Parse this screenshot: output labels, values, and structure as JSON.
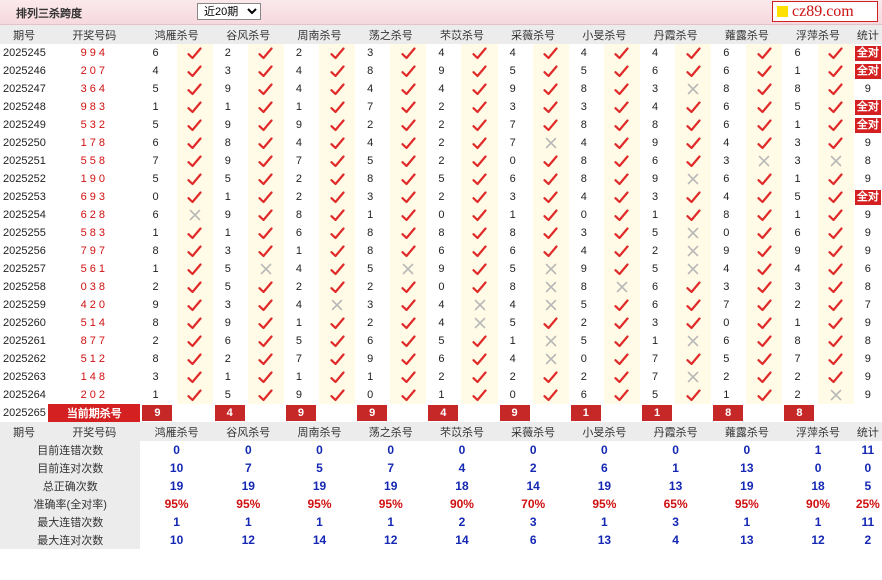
{
  "header": {
    "title": "排列三杀跨度",
    "period_select": "近20期",
    "logo_text": "cz89.com"
  },
  "colors": {
    "accent_red": "#d42020",
    "number_blue": "#1428b4",
    "tick": "#e02a2a",
    "cross": "#b9b9b9"
  },
  "icons": {
    "ok": "check-icon",
    "fail": "cross-icon"
  },
  "table": {
    "col_issue": "期号",
    "col_draw": "开奖号码",
    "col_stat": "统计",
    "experts": [
      "鸿雁杀号",
      "谷风杀号",
      "周南杀号",
      "荡之杀号",
      "芣苡杀号",
      "采薇杀号",
      "小旻杀号",
      "丹霞杀号",
      "蕹露杀号",
      "浮萍杀号"
    ],
    "rows": [
      {
        "issue": "2025245",
        "draw": "994",
        "nums": [
          6,
          2,
          2,
          3,
          4,
          4,
          4,
          4,
          6,
          6
        ],
        "ok": [
          1,
          1,
          1,
          1,
          1,
          1,
          1,
          1,
          1,
          1
        ],
        "stat": "全对"
      },
      {
        "issue": "2025246",
        "draw": "207",
        "nums": [
          4,
          3,
          4,
          8,
          9,
          5,
          5,
          6,
          6,
          1
        ],
        "ok": [
          1,
          1,
          1,
          1,
          1,
          1,
          1,
          1,
          1,
          1
        ],
        "stat": "全对"
      },
      {
        "issue": "2025247",
        "draw": "364",
        "nums": [
          5,
          9,
          4,
          4,
          4,
          9,
          8,
          3,
          8,
          8
        ],
        "ok": [
          1,
          1,
          1,
          1,
          1,
          1,
          1,
          0,
          1,
          1
        ],
        "stat": "9"
      },
      {
        "issue": "2025248",
        "draw": "983",
        "nums": [
          1,
          1,
          1,
          7,
          2,
          3,
          3,
          4,
          6,
          5
        ],
        "ok": [
          1,
          1,
          1,
          1,
          1,
          1,
          1,
          1,
          1,
          1
        ],
        "stat": "全对"
      },
      {
        "issue": "2025249",
        "draw": "532",
        "nums": [
          5,
          9,
          9,
          2,
          2,
          7,
          8,
          8,
          6,
          1
        ],
        "ok": [
          1,
          1,
          1,
          1,
          1,
          1,
          1,
          1,
          1,
          1
        ],
        "stat": "全对"
      },
      {
        "issue": "2025250",
        "draw": "178",
        "nums": [
          6,
          8,
          4,
          4,
          2,
          7,
          4,
          9,
          4,
          3
        ],
        "ok": [
          1,
          1,
          1,
          1,
          1,
          0,
          1,
          1,
          1,
          1
        ],
        "stat": "9"
      },
      {
        "issue": "2025251",
        "draw": "558",
        "nums": [
          7,
          9,
          7,
          5,
          2,
          0,
          8,
          6,
          3,
          3
        ],
        "ok": [
          1,
          1,
          1,
          1,
          1,
          1,
          1,
          1,
          0,
          0
        ],
        "stat": "8"
      },
      {
        "issue": "2025252",
        "draw": "190",
        "nums": [
          5,
          5,
          2,
          8,
          5,
          6,
          8,
          9,
          6,
          1
        ],
        "ok": [
          1,
          1,
          1,
          1,
          1,
          1,
          1,
          0,
          1,
          1
        ],
        "stat": "9"
      },
      {
        "issue": "2025253",
        "draw": "693",
        "nums": [
          0,
          1,
          2,
          3,
          2,
          3,
          4,
          3,
          4,
          5
        ],
        "ok": [
          1,
          1,
          1,
          1,
          1,
          1,
          1,
          1,
          1,
          1
        ],
        "stat": "全对"
      },
      {
        "issue": "2025254",
        "draw": "628",
        "nums": [
          6,
          9,
          8,
          1,
          0,
          1,
          0,
          1,
          8,
          1
        ],
        "ok": [
          0,
          1,
          1,
          1,
          1,
          1,
          1,
          1,
          1,
          1
        ],
        "stat": "9"
      },
      {
        "issue": "2025255",
        "draw": "583",
        "nums": [
          1,
          1,
          6,
          8,
          8,
          8,
          3,
          5,
          0,
          6
        ],
        "ok": [
          1,
          1,
          1,
          1,
          1,
          1,
          1,
          0,
          1,
          1
        ],
        "stat": "9"
      },
      {
        "issue": "2025256",
        "draw": "797",
        "nums": [
          8,
          3,
          1,
          8,
          6,
          6,
          4,
          2,
          9,
          9
        ],
        "ok": [
          1,
          1,
          1,
          1,
          1,
          1,
          1,
          0,
          1,
          1
        ],
        "stat": "9"
      },
      {
        "issue": "2025257",
        "draw": "561",
        "nums": [
          1,
          5,
          4,
          5,
          9,
          5,
          9,
          5,
          4,
          4
        ],
        "ok": [
          1,
          0,
          1,
          0,
          1,
          0,
          1,
          0,
          1,
          1
        ],
        "stat": "6"
      },
      {
        "issue": "2025258",
        "draw": "038",
        "nums": [
          2,
          5,
          2,
          2,
          0,
          8,
          8,
          6,
          3,
          3
        ],
        "ok": [
          1,
          1,
          1,
          1,
          1,
          0,
          0,
          1,
          1,
          1
        ],
        "stat": "8"
      },
      {
        "issue": "2025259",
        "draw": "420",
        "nums": [
          9,
          3,
          4,
          3,
          4,
          4,
          5,
          6,
          7,
          2
        ],
        "ok": [
          1,
          1,
          0,
          1,
          0,
          0,
          1,
          1,
          1,
          1
        ],
        "stat": "7"
      },
      {
        "issue": "2025260",
        "draw": "514",
        "nums": [
          8,
          9,
          1,
          2,
          4,
          5,
          2,
          3,
          0,
          1
        ],
        "ok": [
          1,
          1,
          1,
          1,
          0,
          1,
          1,
          1,
          1,
          1
        ],
        "stat": "9"
      },
      {
        "issue": "2025261",
        "draw": "877",
        "nums": [
          2,
          6,
          5,
          6,
          5,
          1,
          5,
          1,
          6,
          8
        ],
        "ok": [
          1,
          1,
          1,
          1,
          1,
          0,
          1,
          0,
          1,
          1
        ],
        "stat": "8"
      },
      {
        "issue": "2025262",
        "draw": "512",
        "nums": [
          8,
          2,
          7,
          9,
          6,
          4,
          0,
          7,
          5,
          7
        ],
        "ok": [
          1,
          1,
          1,
          1,
          1,
          0,
          1,
          1,
          1,
          1
        ],
        "stat": "9"
      },
      {
        "issue": "2025263",
        "draw": "148",
        "nums": [
          3,
          1,
          1,
          1,
          2,
          2,
          2,
          7,
          2,
          2
        ],
        "ok": [
          1,
          1,
          1,
          1,
          1,
          1,
          1,
          0,
          1,
          1
        ],
        "stat": "9"
      },
      {
        "issue": "2025264",
        "draw": "202",
        "nums": [
          1,
          5,
          9,
          0,
          1,
          0,
          6,
          5,
          1,
          2
        ],
        "ok": [
          1,
          1,
          1,
          1,
          1,
          1,
          1,
          1,
          1,
          0
        ],
        "stat": "9"
      }
    ],
    "current": {
      "issue": "2025265",
      "label": "当前期杀号",
      "nums": [
        "9",
        "4",
        "9",
        "9",
        "4",
        "9",
        "1",
        "1",
        "8",
        "8"
      ]
    }
  },
  "stats": {
    "rows": [
      {
        "label": "目前连错次数",
        "values": [
          "0",
          "0",
          "0",
          "0",
          "0",
          "0",
          "0",
          "0",
          "0",
          "1",
          "11"
        ],
        "red": false
      },
      {
        "label": "目前连对次数",
        "values": [
          "10",
          "7",
          "5",
          "7",
          "4",
          "2",
          "6",
          "1",
          "13",
          "0",
          "0"
        ],
        "red": false
      },
      {
        "label": "总正确次数",
        "values": [
          "19",
          "19",
          "19",
          "19",
          "18",
          "14",
          "19",
          "13",
          "19",
          "18",
          "5"
        ],
        "red": false
      },
      {
        "label": "准确率(全对率)",
        "values": [
          "95%",
          "95%",
          "95%",
          "95%",
          "90%",
          "70%",
          "95%",
          "65%",
          "95%",
          "90%",
          "25%"
        ],
        "red": true
      },
      {
        "label": "最大连错次数",
        "values": [
          "1",
          "1",
          "1",
          "1",
          "2",
          "3",
          "1",
          "3",
          "1",
          "1",
          "11"
        ],
        "red": false
      },
      {
        "label": "最大连对次数",
        "values": [
          "10",
          "12",
          "14",
          "12",
          "14",
          "6",
          "13",
          "4",
          "13",
          "12",
          "2"
        ],
        "red": false
      }
    ]
  }
}
